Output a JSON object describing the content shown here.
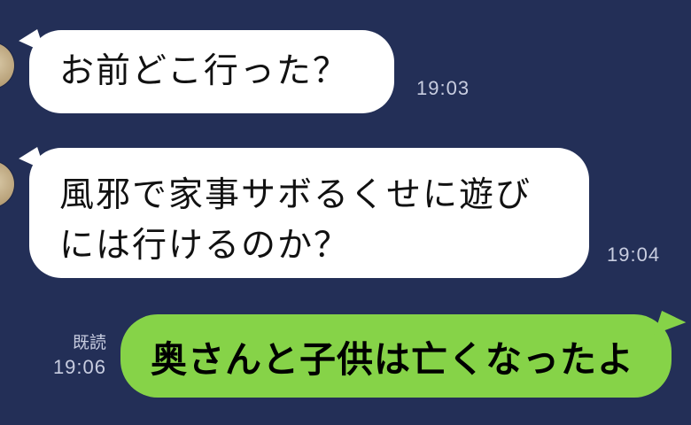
{
  "messages": [
    {
      "direction": "incoming",
      "text": "お前どこ行った？",
      "time": "19:03"
    },
    {
      "direction": "incoming",
      "lines": [
        "風邪で家事サボるくせに遊び",
        "には行けるのか？"
      ],
      "time": "19:04"
    },
    {
      "direction": "outgoing",
      "text": "奥さんと子供は亡くなったよ",
      "read_label": "既読",
      "time": "19:06"
    }
  ],
  "colors": {
    "background": "#232f57",
    "incoming_bubble": "#ffffff",
    "outgoing_bubble": "#86d348",
    "timestamp": "#c8cde0"
  }
}
